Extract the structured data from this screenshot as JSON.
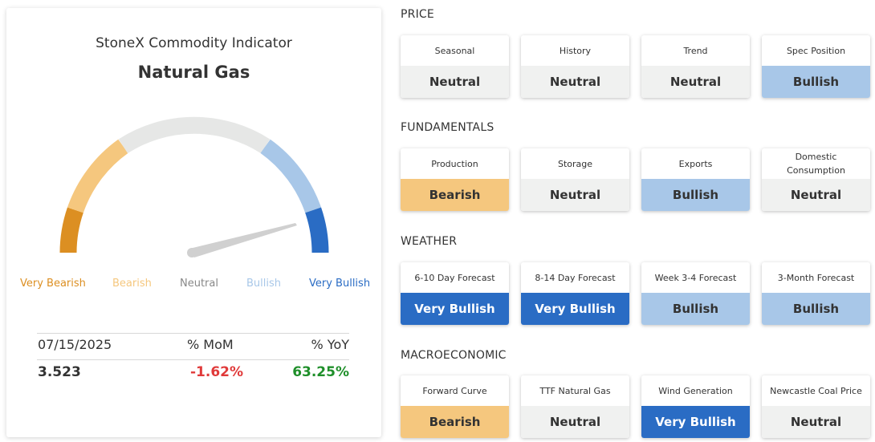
{
  "indicator": {
    "title": "StoneX Commodity Indicator",
    "commodity": "Natural Gas",
    "gauge": {
      "labels": {
        "very_bearish": "Very Bearish",
        "bearish": "Bearish",
        "neutral": "Neutral",
        "bullish": "Bullish",
        "very_bullish": "Very Bullish"
      },
      "colors": {
        "very_bearish": "#dc8f22",
        "bearish": "#f5c77e",
        "neutral": "#e6e7e6",
        "bullish": "#a8c7e8",
        "very_bullish": "#2a6cc4",
        "needle": "#d0d0d0"
      }
    },
    "stats": {
      "date": "07/15/2025",
      "mom_label": "% MoM",
      "yoy_label": "% YoY",
      "price": "3.523",
      "mom": "-1.62%",
      "yoy": "63.25%",
      "mom_color": "#e03a3a",
      "yoy_color": "#1f8f2a"
    }
  },
  "sections": [
    {
      "title": "PRICE",
      "cards": [
        {
          "label": "Seasonal",
          "value": "Neutral"
        },
        {
          "label": "History",
          "value": "Neutral"
        },
        {
          "label": "Trend",
          "value": "Neutral"
        },
        {
          "label": "Spec Position",
          "value": "Bullish"
        }
      ]
    },
    {
      "title": "FUNDAMENTALS",
      "cards": [
        {
          "label": "Production",
          "value": "Bearish"
        },
        {
          "label": "Storage",
          "value": "Neutral"
        },
        {
          "label": "Exports",
          "value": "Bullish"
        },
        {
          "label": "Domestic Consumption",
          "value": "Neutral"
        }
      ]
    },
    {
      "title": "WEATHER",
      "cards": [
        {
          "label": "6-10 Day Forecast",
          "value": "Very Bullish"
        },
        {
          "label": "8-14 Day Forecast",
          "value": "Very Bullish"
        },
        {
          "label": "Week 3-4 Forecast",
          "value": "Bullish"
        },
        {
          "label": "3-Month Forecast",
          "value": "Bullish"
        }
      ]
    },
    {
      "title": "MACROECONOMIC",
      "cards": [
        {
          "label": "Forward Curve",
          "value": "Bearish"
        },
        {
          "label": "TTF Natural Gas",
          "value": "Neutral"
        },
        {
          "label": "Wind Generation",
          "value": "Very Bullish"
        },
        {
          "label": "Newcastle Coal Price",
          "value": "Neutral"
        }
      ]
    }
  ]
}
